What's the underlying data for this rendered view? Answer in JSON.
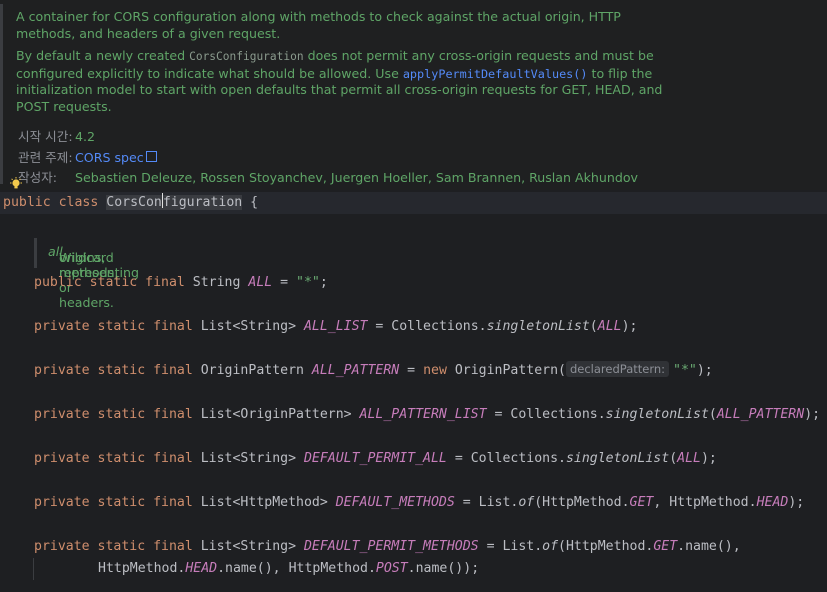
{
  "javadoc": {
    "summary": "A container for CORS configuration along with methods to check against the actual origin, HTTP methods, and headers of a given request.",
    "desc_part1": "By default a newly created ",
    "desc_code": "CorsConfiguration",
    "desc_part2": " does not permit any cross-origin requests and must be configured explicitly to indicate what should be allowed. Use ",
    "desc_link": "applyPermitDefaultValues()",
    "desc_part3": " to flip the initialization model to start with open defaults that permit all cross-origin requests for GET, HEAD, and POST requests.",
    "since_label": "시작 시간:",
    "since_value": "4.2",
    "see_label": "관련 주제:",
    "see_value": "CORS spec",
    "author_label": "작성자:",
    "author_value": "Sebastien Deleuze, Rossen Stoyanchev, Juergen Hoeller, Sam Brannen, Ruslan Akhundov"
  },
  "code": {
    "class_decl": {
      "kw1": "public",
      "kw2": "class",
      "name_a": "CorsCon",
      "name_b": "figuration",
      "brace": " {"
    },
    "wildcard_doc_a": "Wildcard representing ",
    "wildcard_doc_em": "all",
    "wildcard_doc_b": " origins, methods, or headers.",
    "l1": {
      "mods": "public static final",
      "type": " String ",
      "field": "ALL",
      "rest_a": " = ",
      "str": "\"*\"",
      "rest_b": ";"
    },
    "l2": {
      "mods": "private static final",
      "type": " List<String> ",
      "field": "ALL_LIST",
      "rest_a": " = Collections.",
      "method": "singletonList",
      "arg": "ALL",
      "rest_b": ");"
    },
    "l3": {
      "mods": "private static final",
      "type": " OriginPattern ",
      "field": "ALL_PATTERN",
      "rest_a": " = ",
      "kw": "new",
      "rest_c": " OriginPattern(",
      "hint": "declaredPattern:",
      "str": "\"*\"",
      "rest_b": ");"
    },
    "l4": {
      "mods": "private static final",
      "type": " List<OriginPattern> ",
      "field": "ALL_PATTERN_LIST",
      "rest_a": " = Collections.",
      "method": "singletonList",
      "arg": "ALL_PATTERN",
      "rest_b": ");"
    },
    "l5": {
      "mods": "private static final",
      "type": " List<String> ",
      "field": "DEFAULT_PERMIT_ALL",
      "rest_a": " = Collections.",
      "method": "singletonList",
      "arg": "ALL",
      "rest_b": ");"
    },
    "l6": {
      "mods": "private static final",
      "type": " List<HttpMethod> ",
      "field": "DEFAULT_METHODS",
      "rest_a": " = List.",
      "method": "of",
      "p1": "(HttpMethod.",
      "c1": "GET",
      "p2": ", HttpMethod.",
      "c2": "HEAD",
      "rest_b": ");"
    },
    "l7": {
      "mods": "private static final",
      "type": " List<String> ",
      "field": "DEFAULT_PERMIT_METHODS",
      "rest_a": " = List.",
      "method": "of",
      "p1": "(HttpMethod.",
      "c1": "GET",
      "p2": ".name(),"
    },
    "l8": {
      "p0": "HttpMethod.",
      "c1": "HEAD",
      "p1": ".name(), HttpMethod.",
      "c2": "POST",
      "p2": ".name());"
    }
  }
}
